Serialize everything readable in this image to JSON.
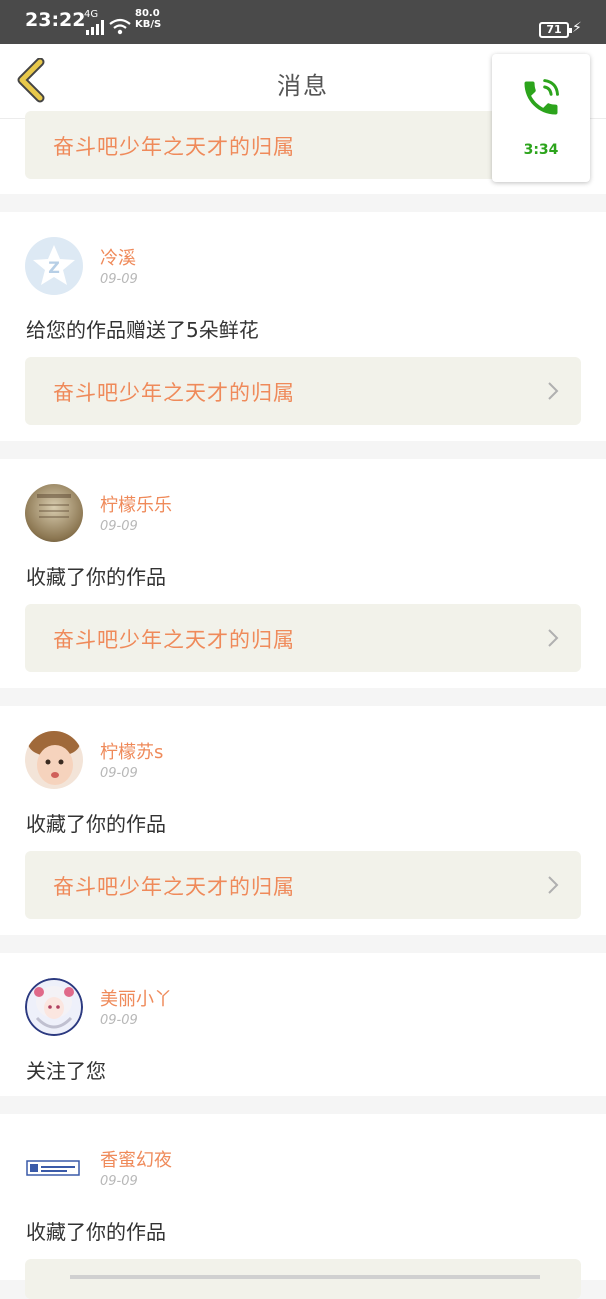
{
  "status_bar": {
    "time": "23:22",
    "network": "4G",
    "speed_value": "80.0",
    "speed_unit": "KB/S",
    "battery": "71"
  },
  "header": {
    "title": "消息"
  },
  "call_widget": {
    "duration": "3:34"
  },
  "top_card": {
    "work_title": "奋斗吧少年之天才的归属"
  },
  "messages": [
    {
      "username": "冷溪",
      "date": "09-09",
      "action": "给您的作品赠送了5朵鲜花",
      "work_title": "奋斗吧少年之天才的归属",
      "avatar_icon": "qzone-star-icon"
    },
    {
      "username": "柠檬乐乐",
      "date": "09-09",
      "action": "收藏了你的作品",
      "work_title": "奋斗吧少年之天才的归属",
      "avatar_icon": "photo-avatar"
    },
    {
      "username": "柠檬苏s",
      "date": "09-09",
      "action": "收藏了你的作品",
      "work_title": "奋斗吧少年之天才的归属",
      "avatar_icon": "child-avatar"
    },
    {
      "username": "美丽小丫",
      "date": "09-09",
      "action": "关注了您",
      "avatar_icon": "anime-avatar"
    },
    {
      "username": "香蜜幻夜",
      "date": "09-09",
      "action": "收藏了你的作品",
      "avatar_icon": "logo-avatar"
    }
  ],
  "colors": {
    "accent": "#ef8a5a",
    "call_green": "#2ca41c",
    "back_arrow": "#e8c84a",
    "work_bg": "#f2f2ea"
  }
}
